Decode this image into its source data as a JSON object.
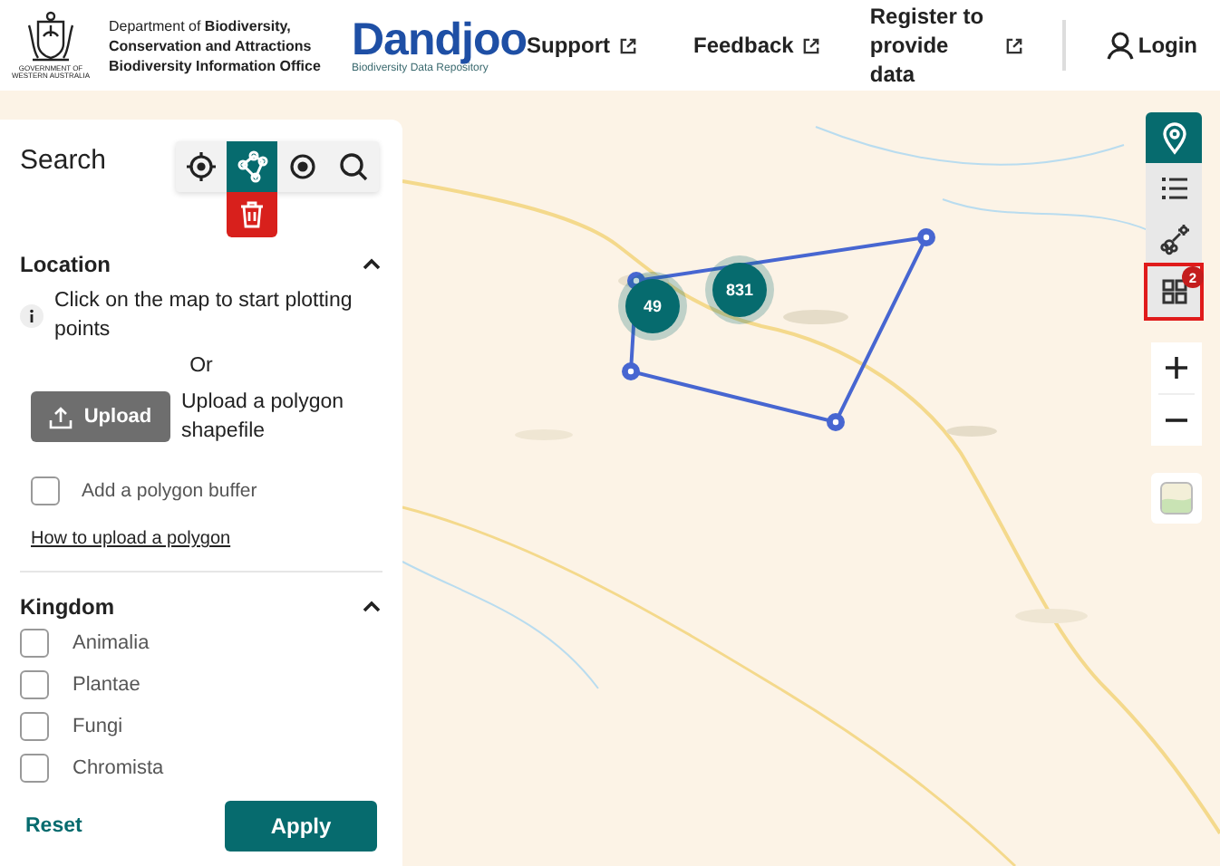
{
  "header": {
    "emblem_caption": [
      "GOVERNMENT OF",
      "WESTERN AUSTRALIA"
    ],
    "org_lines": [
      "Department of **Biodiversity,**",
      "Conservation and Attractions",
      "Biodiversity Information Office"
    ],
    "brand": "Dandjoo",
    "brand_subtitle": "Biodiversity Data Repository",
    "nav": [
      {
        "label": "Support"
      },
      {
        "label": "Feedback"
      },
      {
        "label": "Register to provide data"
      }
    ],
    "login": "Login"
  },
  "sidebar": {
    "title": "Search",
    "tools": [
      {
        "kind": "locate",
        "selected": false
      },
      {
        "kind": "polygon",
        "selected": true
      },
      {
        "kind": "circle",
        "selected": false
      },
      {
        "kind": "search",
        "selected": false
      }
    ],
    "location": {
      "title": "Location",
      "expanded": true,
      "info": "Click on the map to start plotting points",
      "or": "Or",
      "upload_button": "Upload",
      "upload_text": "Upload a polygon shapefile",
      "buffer": {
        "label": "Add a polygon buffer",
        "checked": false
      },
      "help_link": "How to upload a polygon"
    },
    "kingdom": {
      "title": "Kingdom",
      "expanded": true,
      "options": [
        {
          "label": "Animalia",
          "checked": false
        },
        {
          "label": "Plantae",
          "checked": false
        },
        {
          "label": "Fungi",
          "checked": false
        },
        {
          "label": "Chromista",
          "checked": false
        }
      ]
    },
    "reset": "Reset",
    "apply": "Apply"
  },
  "map": {
    "clusters": [
      {
        "count": "49"
      },
      {
        "count": "831"
      }
    ],
    "layers": [
      {
        "kind": "pin",
        "selected": true,
        "outlined": false
      },
      {
        "kind": "list",
        "selected": false,
        "outlined": false
      },
      {
        "kind": "flower",
        "selected": false,
        "outlined": false
      },
      {
        "kind": "grid",
        "selected": false,
        "outlined": true,
        "badge": "2"
      }
    ]
  }
}
